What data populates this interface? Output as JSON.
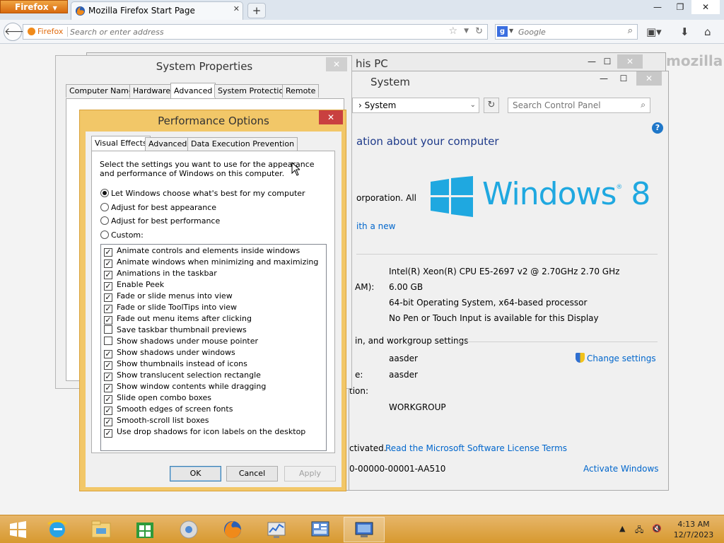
{
  "firefox": {
    "menu_label": "Firefox",
    "tab_title": "Mozilla Firefox Start Page",
    "identity_label": "Firefox",
    "url_placeholder": "Search or enter address",
    "search_placeholder": "Google",
    "brand_watermark": "mozilla"
  },
  "this_pc": {
    "title": "his PC"
  },
  "system_window": {
    "title": "System",
    "breadcrumb": "System",
    "search_placeholder": "Search Control Panel",
    "heading": "ation about your computer",
    "copyright": "orporation. All",
    "new_link": "ith a new",
    "windows_logo_text": "Windows",
    "windows_logo_version": "8",
    "specs": [
      {
        "label": "",
        "value": "Intel(R) Xeon(R) CPU E5-2697 v2 @ 2.70GHz   2.70 GHz"
      },
      {
        "label": "AM):",
        "value": "6.00 GB"
      },
      {
        "label": "",
        "value": "64-bit Operating System, x64-based processor"
      },
      {
        "label": "",
        "value": "No Pen or Touch Input is available for this Display"
      }
    ],
    "domain_section": "in, and workgroup settings",
    "computer_name": "aasder",
    "full_name_label": "e:",
    "full_name": "aasder",
    "description_label": "tion:",
    "workgroup": "WORKGROUP",
    "change_settings": "Change settings",
    "activated": "ctivated.",
    "license_link": "Read the Microsoft Software License Terms",
    "product_id": "0-00000-00001-AA510",
    "activate_link": "Activate Windows"
  },
  "system_properties": {
    "title": "System Properties",
    "tabs": [
      "Computer Name",
      "Hardware",
      "Advanced",
      "System Protection",
      "Remote"
    ],
    "active_tab": "Advanced"
  },
  "performance_options": {
    "title": "Performance Options",
    "tabs": [
      "Visual Effects",
      "Advanced",
      "Data Execution Prevention"
    ],
    "active_tab": "Visual Effects",
    "description": "Select the settings you want to use for the appearance and performance of Windows on this computer.",
    "radios": [
      {
        "label": "Let Windows choose what's best for my computer",
        "checked": true
      },
      {
        "label": "Adjust for best appearance",
        "checked": false
      },
      {
        "label": "Adjust for best performance",
        "checked": false
      },
      {
        "label": "Custom:",
        "checked": false
      }
    ],
    "effects": [
      {
        "label": "Animate controls and elements inside windows",
        "checked": true
      },
      {
        "label": "Animate windows when minimizing and maximizing",
        "checked": true
      },
      {
        "label": "Animations in the taskbar",
        "checked": true
      },
      {
        "label": "Enable Peek",
        "checked": true
      },
      {
        "label": "Fade or slide menus into view",
        "checked": true
      },
      {
        "label": "Fade or slide ToolTips into view",
        "checked": true
      },
      {
        "label": "Fade out menu items after clicking",
        "checked": true
      },
      {
        "label": "Save taskbar thumbnail previews",
        "checked": false
      },
      {
        "label": "Show shadows under mouse pointer",
        "checked": false
      },
      {
        "label": "Show shadows under windows",
        "checked": true
      },
      {
        "label": "Show thumbnails instead of icons",
        "checked": true
      },
      {
        "label": "Show translucent selection rectangle",
        "checked": true
      },
      {
        "label": "Show window contents while dragging",
        "checked": true
      },
      {
        "label": "Slide open combo boxes",
        "checked": true
      },
      {
        "label": "Smooth edges of screen fonts",
        "checked": true
      },
      {
        "label": "Smooth-scroll list boxes",
        "checked": true
      },
      {
        "label": "Use drop shadows for icon labels on the desktop",
        "checked": true
      }
    ],
    "ok_label": "OK",
    "cancel_label": "Cancel",
    "apply_label": "Apply"
  },
  "taskbar": {
    "icons": [
      "start-icon",
      "internet-explorer-icon",
      "file-explorer-icon",
      "store-icon",
      "chrome-icon",
      "firefox-icon",
      "performance-monitor-icon",
      "control-panel-icon",
      "system-properties-icon"
    ],
    "time": "4:13 AM",
    "date": "12/7/2023"
  },
  "colors": {
    "taskbar": "#d7992f",
    "dialog_frame": "#f2c768",
    "close_button": "#c94040",
    "windows_blue": "#1fa8e0",
    "link": "#0066cc"
  }
}
